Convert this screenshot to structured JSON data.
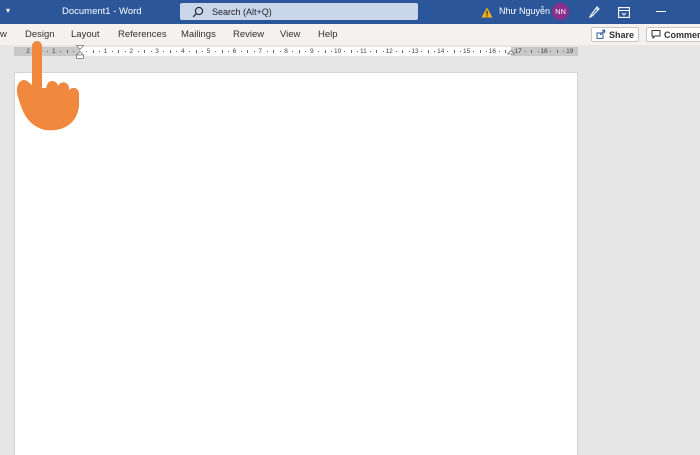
{
  "titlebar": {
    "qat_dropdown": "▾",
    "doc_title": "Document1  -  Word",
    "search_placeholder": "Search (Alt+Q)",
    "user_name": "Như Nguyễn",
    "avatar_initials": "NN",
    "accent_color": "#2b579a"
  },
  "tabs": [
    {
      "label": "w"
    },
    {
      "label": "Design"
    },
    {
      "label": "Layout"
    },
    {
      "label": "References"
    },
    {
      "label": "Mailings"
    },
    {
      "label": "Review"
    },
    {
      "label": "View"
    },
    {
      "label": "Help"
    }
  ],
  "actions": {
    "share_label": "Share",
    "comments_label": "Comments"
  },
  "ruler": {
    "labels": [
      "2",
      "1",
      "",
      "1",
      "2",
      "3",
      "4",
      "5",
      "6",
      "7",
      "8",
      "9",
      "10",
      "11",
      "12",
      "13",
      "14",
      "15",
      "16",
      "17",
      "18",
      "19"
    ]
  },
  "overlay": {
    "pointer_color": "#f0883e"
  }
}
